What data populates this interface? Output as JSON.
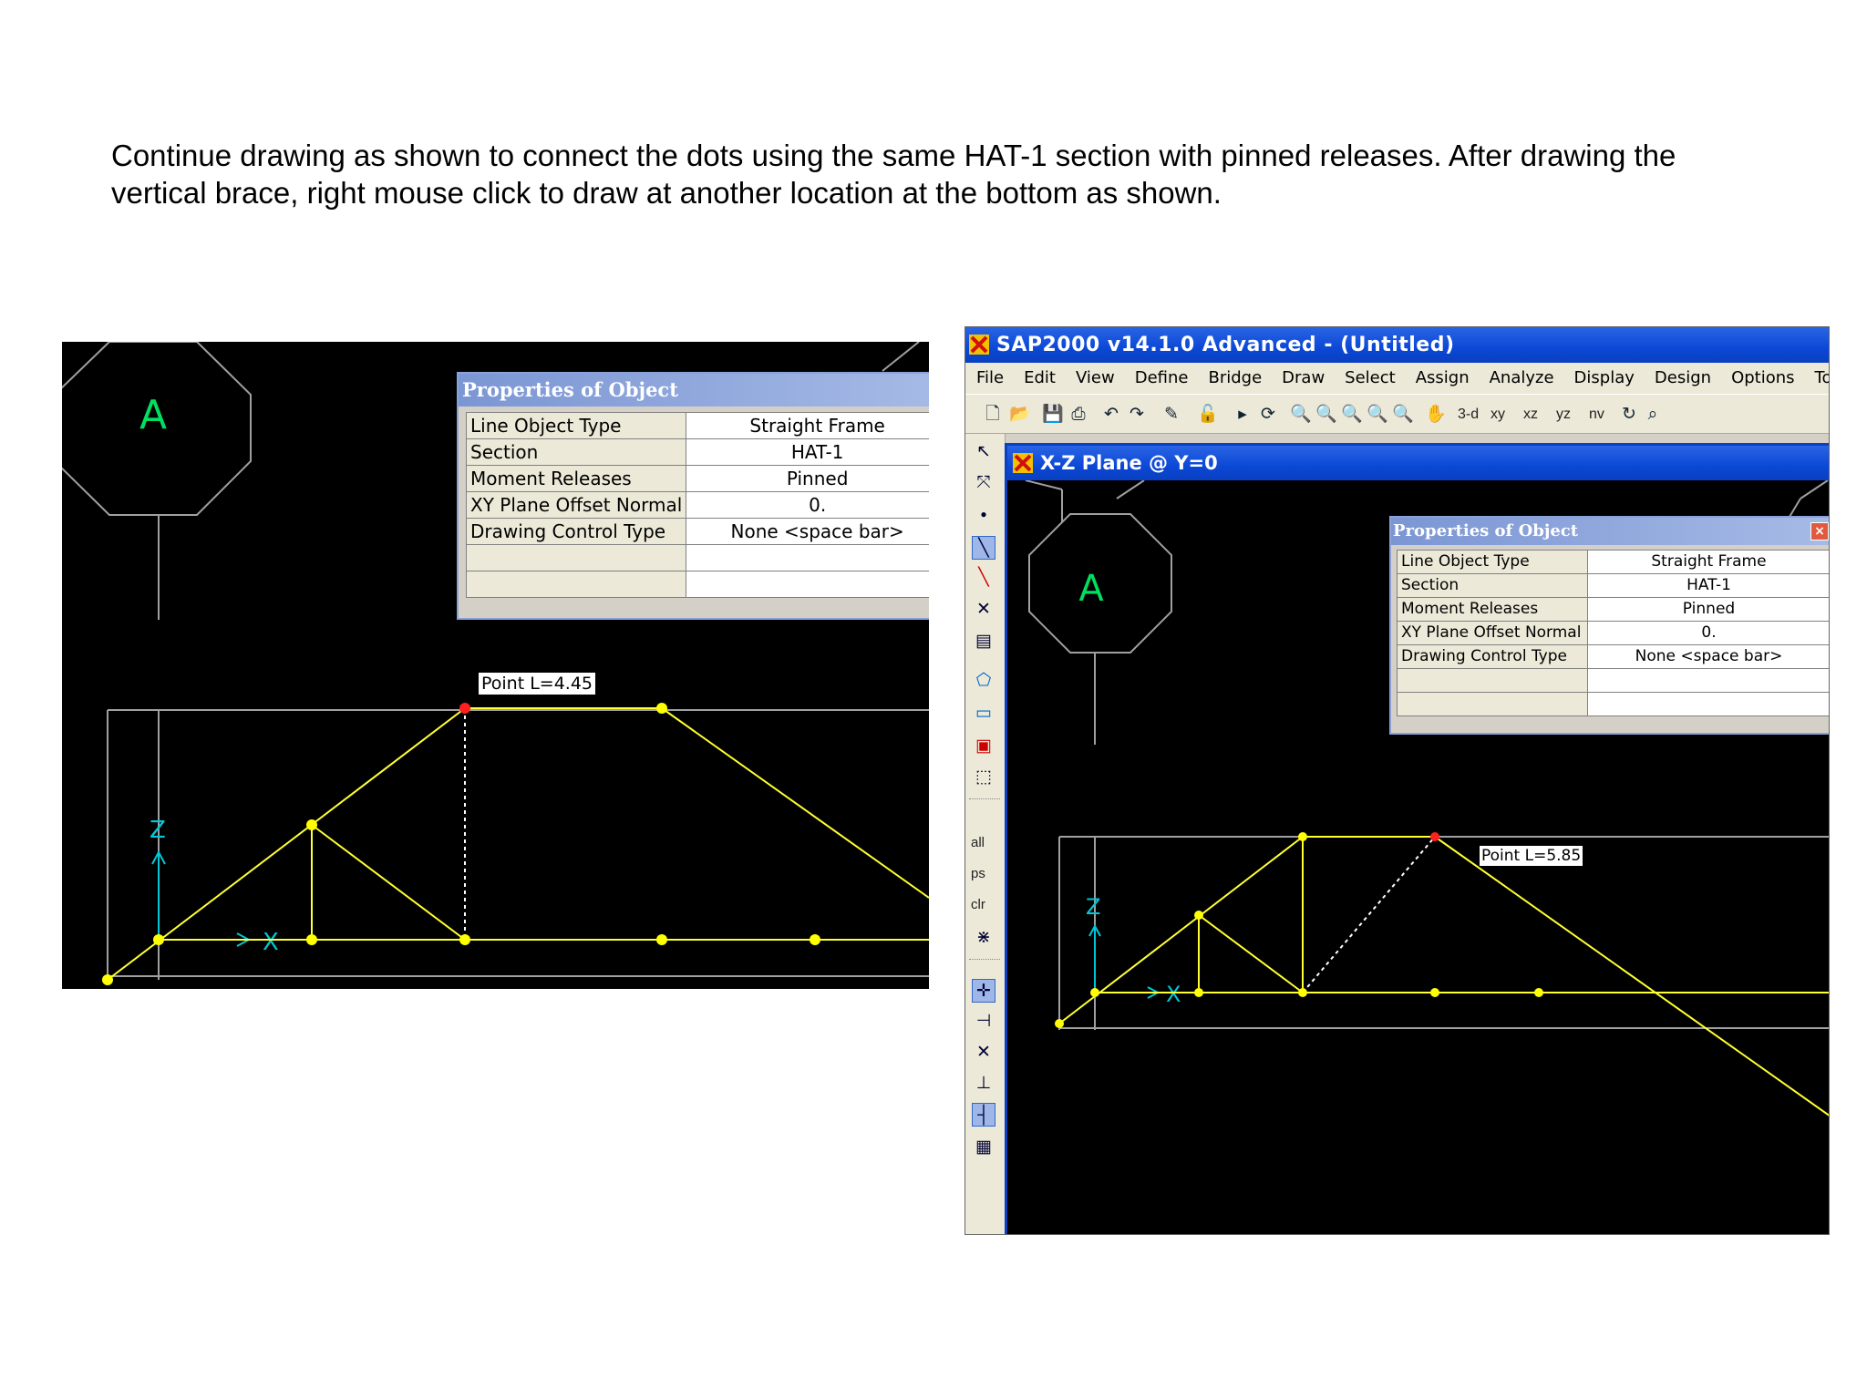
{
  "instructions": {
    "line1": "Continue drawing as shown to connect the dots using the same HAT-1 section with pinned releases. After drawing the",
    "line2": "vertical brace, right mouse click to draw at another location at the bottom as shown."
  },
  "left_panel": {
    "properties": {
      "title": "Properties of Object",
      "rows": [
        {
          "label": "Line Object Type",
          "value": "Straight Frame"
        },
        {
          "label": "Section",
          "value": "HAT-1"
        },
        {
          "label": "Moment Releases",
          "value": "Pinned"
        },
        {
          "label": "XY Plane Offset Normal",
          "value": "0."
        },
        {
          "label": "Drawing Control Type",
          "value": "None  <space bar>"
        },
        {
          "label": "",
          "value": ""
        },
        {
          "label": "",
          "value": ""
        }
      ]
    },
    "point_tooltip": "Point  L=4.45",
    "grid_bubble": "A",
    "axis_z": "Z",
    "axis_x": "X"
  },
  "right_panel": {
    "app_title": "SAP2000 v14.1.0 Advanced  - (Untitled)",
    "menu": [
      "File",
      "Edit",
      "View",
      "Define",
      "Bridge",
      "Draw",
      "Select",
      "Assign",
      "Analyze",
      "Display",
      "Design",
      "Options",
      "Too"
    ],
    "toolbar_text": {
      "view_3d": "3-d",
      "view_xy": "xy",
      "view_xz": "xz",
      "view_yz": "yz",
      "view_nv": "nv"
    },
    "left_toolbar_text": {
      "all": "all",
      "ps": "ps",
      "clr": "clr"
    },
    "window_title": "X-Z Plane @ Y=0",
    "properties": {
      "title": "Properties of Object",
      "close": "×",
      "rows": [
        {
          "label": "Line Object Type",
          "value": "Straight Frame"
        },
        {
          "label": "Section",
          "value": "HAT-1"
        },
        {
          "label": "Moment Releases",
          "value": "Pinned"
        },
        {
          "label": "XY Plane Offset Normal",
          "value": "0."
        },
        {
          "label": "Drawing Control Type",
          "value": "None  <space bar>"
        },
        {
          "label": "",
          "value": ""
        },
        {
          "label": "",
          "value": ""
        }
      ]
    },
    "point_tooltip": "Point  L=5.85",
    "grid_bubble": "A",
    "axis_z": "Z",
    "axis_x": "X"
  },
  "colors": {
    "canvas_bg": "#000000",
    "frame_line": "#ffff33",
    "joint": "#ffff00",
    "selected_point": "#ff2020",
    "grid_line": "#a0a0a0",
    "axis": "#00c8d8",
    "bubble_text": "#00e060",
    "title_blue": "#0b48d6"
  }
}
